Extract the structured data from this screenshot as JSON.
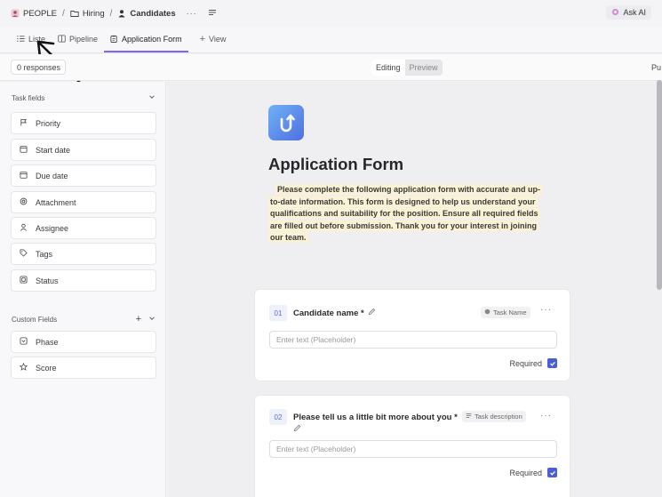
{
  "breadcrumb": {
    "space": "PEOPLE",
    "folder": "Hiring",
    "list": "Candidates"
  },
  "header": {
    "ask_ai": "Ask AI"
  },
  "tabs": [
    {
      "label": "Liste",
      "icon": "list-icon"
    },
    {
      "label": "Pipeline",
      "icon": "board-icon"
    },
    {
      "label": "Application Form",
      "icon": "form-icon",
      "active": true
    },
    {
      "label": "View",
      "icon": "plus-icon"
    }
  ],
  "subbar": {
    "responses": "0 responses",
    "editing": "Editing",
    "preview": "Preview",
    "publish": "Pu"
  },
  "sidebar": {
    "task_fields_label": "Task fields",
    "task_fields": [
      {
        "label": "Priority",
        "icon": "flag-icon"
      },
      {
        "label": "Start date",
        "icon": "calendar-icon"
      },
      {
        "label": "Due date",
        "icon": "calendar-icon"
      },
      {
        "label": "Attachment",
        "icon": "paperclip-icon"
      },
      {
        "label": "Assignee",
        "icon": "user-icon"
      },
      {
        "label": "Tags",
        "icon": "tag-icon"
      },
      {
        "label": "Status",
        "icon": "status-icon"
      }
    ],
    "custom_fields_label": "Custom Fields",
    "custom_fields": [
      {
        "label": "Phase",
        "icon": "dropdown-icon"
      },
      {
        "label": "Score",
        "icon": "star-icon"
      }
    ]
  },
  "form": {
    "title": "Application Form",
    "description": "Please complete the following application form with accurate and up-to-date information. This form is designed to help us understand your qualifications and suitability for the position. Ensure all required fields are filled out before submission. Thank you for your interest in joining our team.",
    "questions": [
      {
        "number": "01",
        "title": "Candidate name *",
        "tag": "Task Name",
        "placeholder": "Enter text (Placeholder)",
        "required_label": "Required"
      },
      {
        "number": "02",
        "title": "Please tell us a little bit more about you *",
        "tag": "Task description",
        "placeholder": "Enter text (Placeholder)",
        "required_label": "Required"
      }
    ]
  },
  "colors": {
    "accent": "#7b68ee",
    "checkbox": "#4a5fd6",
    "highlight": "#faf2d2"
  }
}
